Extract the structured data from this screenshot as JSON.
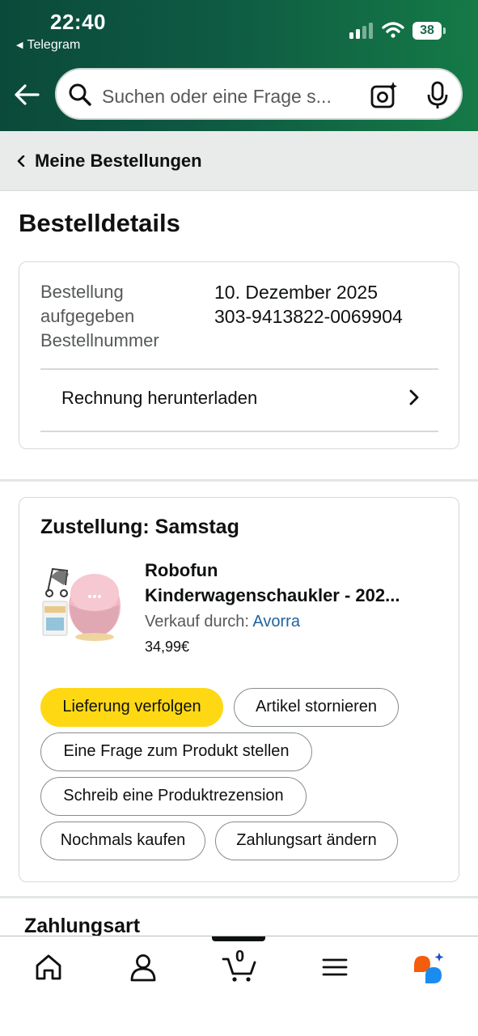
{
  "status_bar": {
    "time": "22:40",
    "back_app": "Telegram",
    "battery": "38"
  },
  "search": {
    "placeholder": "Suchen oder eine Frage s..."
  },
  "breadcrumb": {
    "label": "Meine Bestellungen"
  },
  "page_title": "Bestelldetails",
  "order_info": {
    "label_line1": "Bestellung",
    "label_line2": "aufgegeben",
    "label_line3": "Bestellnummer",
    "date": "10. Dezember 2025",
    "order_number": "303-9413822-0069904",
    "invoice_label": "Rechnung herunterladen"
  },
  "delivery": {
    "title": "Zustellung: Samstag",
    "product_name_line1": "Robofun",
    "product_name_line2": "Kinderwagenschaukler - 202...",
    "seller_prefix": "Verkauf durch: ",
    "seller_name": "Avorra",
    "price": "34,99€",
    "actions": {
      "track": "Lieferung verfolgen",
      "cancel": "Artikel stornieren",
      "ask": "Eine Frage zum Produkt stellen",
      "review": "Schreib eine Produktrezension",
      "buy_again": "Nochmals kaufen",
      "change_payment": "Zahlungsart ändern"
    }
  },
  "payment_section": {
    "title": "Zahlungsart"
  },
  "tabbar": {
    "cart_count": "0",
    "tabs": [
      "home-icon",
      "account-icon",
      "cart-icon",
      "menu-icon",
      "assistant-icon"
    ]
  },
  "colors": {
    "header_start": "#0b4a3a",
    "header_end": "#157a46",
    "primary_button": "#ffd814",
    "link": "#2162a1"
  }
}
